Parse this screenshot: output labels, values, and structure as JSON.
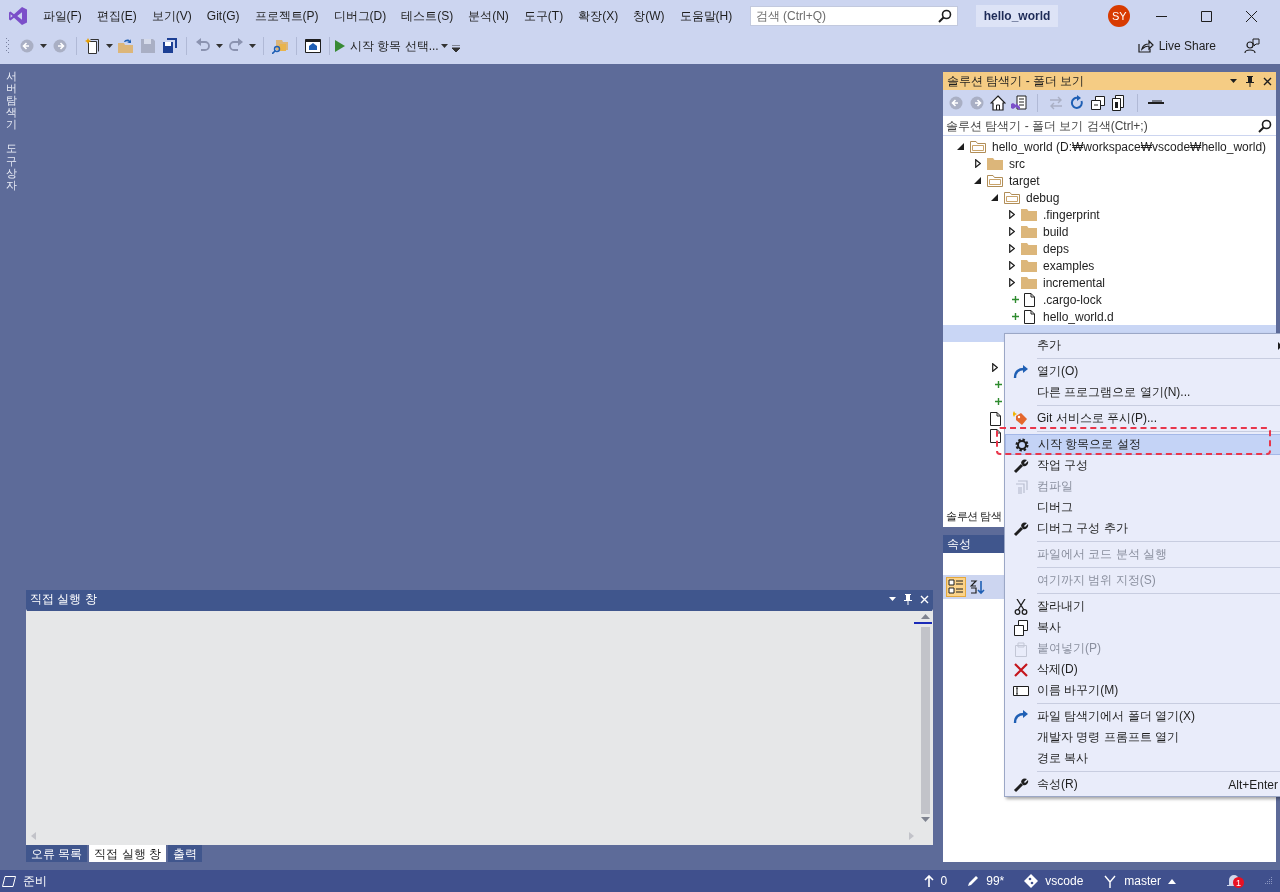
{
  "menu_bar": {
    "items": [
      "파일(F)",
      "편집(E)",
      "보기(V)",
      "Git(G)",
      "프로젝트(P)",
      "디버그(D)",
      "테스트(S)",
      "분석(N)",
      "도구(T)",
      "확장(X)",
      "창(W)",
      "도움말(H)"
    ]
  },
  "search": {
    "placeholder": "검색 (Ctrl+Q)"
  },
  "project_name": "hello_world",
  "account": {
    "initials": "SY"
  },
  "toolbar": {
    "start_button": "시작 항목 선택...",
    "live_share": "Live Share"
  },
  "side_tabs": [
    "서버 탐색기",
    "도구 상자"
  ],
  "solution_explorer": {
    "title": "솔루션 탐색기 - 폴더 보기",
    "search": {
      "placeholder": "솔루션 탐색기 - 폴더 보기 검색(Ctrl+;)"
    },
    "tree": [
      {
        "label": "hello_world (D:₩workspace₩vscode₩hello_world)",
        "kind": "folder",
        "expanded": true,
        "selected": false,
        "children": [
          {
            "label": "src",
            "kind": "folder",
            "expanded": false,
            "selected": false
          },
          {
            "label": "target",
            "kind": "folder",
            "expanded": true,
            "selected": false,
            "children": [
              {
                "label": "debug",
                "kind": "folder",
                "expanded": true,
                "selected": false,
                "children": [
                  {
                    "label": ".fingerprint",
                    "kind": "folder",
                    "expanded": false,
                    "selected": false
                  },
                  {
                    "label": "build",
                    "kind": "folder",
                    "expanded": false,
                    "selected": false
                  },
                  {
                    "label": "deps",
                    "kind": "folder",
                    "expanded": false,
                    "selected": false
                  },
                  {
                    "label": "examples",
                    "kind": "folder",
                    "expanded": false,
                    "selected": false
                  },
                  {
                    "label": "incremental",
                    "kind": "folder",
                    "expanded": false,
                    "selected": false
                  },
                  {
                    "label": ".cargo-lock",
                    "kind": "file",
                    "added": true,
                    "selected": false
                  },
                  {
                    "label": "hello_world.d",
                    "kind": "file",
                    "added": true,
                    "selected": false
                  },
                  {
                    "kind": "file",
                    "added": false,
                    "selected": true
                  },
                  {
                    "kind": "file",
                    "added": false,
                    "selected": false
                  }
                ]
              },
              {
                "kind": "folder",
                "expanded": false,
                "selected": false
              },
              {
                "kind": "file",
                "added": true,
                "selected": false
              },
              {
                "kind": "file",
                "added": true,
                "selected": false
              }
            ]
          },
          {
            "kind": "file",
            "added": false,
            "selected": false
          },
          {
            "kind": "file",
            "added": false,
            "selected": false
          }
        ]
      }
    ],
    "tabs": [
      {
        "label": "솔루션 탐색",
        "selected": true
      }
    ]
  },
  "properties": {
    "title": "속성"
  },
  "immediate_window": {
    "title": "직접 실행 창",
    "tabs": [
      {
        "label": "오류 목록",
        "selected": false
      },
      {
        "label": "직접 실행 창",
        "selected": true
      },
      {
        "label": "출력",
        "selected": false
      }
    ]
  },
  "context_menu": {
    "items": [
      {
        "kind": "item",
        "label": "추가",
        "disabled": false,
        "selected": false,
        "submenu": true
      },
      {
        "kind": "separator"
      },
      {
        "kind": "item",
        "label": "열기(O)",
        "disabled": false,
        "selected": false,
        "submenu": false
      },
      {
        "kind": "item",
        "label": "다른 프로그램으로 열기(N)...",
        "disabled": false,
        "selected": false,
        "submenu": false
      },
      {
        "kind": "separator"
      },
      {
        "kind": "item",
        "label": "Git 서비스로 푸시(P)...",
        "disabled": false,
        "selected": false,
        "submenu": false
      },
      {
        "kind": "separator"
      },
      {
        "kind": "item",
        "label": "시작 항목으로 설정",
        "disabled": false,
        "selected": true,
        "submenu": false
      },
      {
        "kind": "item",
        "label": "작업 구성",
        "disabled": false,
        "selected": false,
        "submenu": false
      },
      {
        "kind": "item",
        "label": "컴파일",
        "disabled": true,
        "selected": false,
        "submenu": false
      },
      {
        "kind": "item",
        "label": "디버그",
        "disabled": false,
        "selected": false,
        "submenu": false
      },
      {
        "kind": "item",
        "label": "디버그 구성 추가",
        "disabled": false,
        "selected": false,
        "submenu": false
      },
      {
        "kind": "separator"
      },
      {
        "kind": "item",
        "label": "파일에서 코드 분석 실행",
        "disabled": true,
        "selected": false,
        "submenu": false
      },
      {
        "kind": "separator"
      },
      {
        "kind": "item",
        "label": "여기까지 범위 지정(S)",
        "disabled": true,
        "selected": false,
        "submenu": false
      },
      {
        "kind": "separator"
      },
      {
        "kind": "item",
        "label": "잘라내기",
        "disabled": false,
        "selected": false,
        "submenu": false
      },
      {
        "kind": "item",
        "label": "복사",
        "disabled": false,
        "selected": false,
        "submenu": false
      },
      {
        "kind": "item",
        "label": "붙여넣기(P)",
        "disabled": true,
        "selected": false,
        "submenu": false
      },
      {
        "kind": "item",
        "label": "삭제(D)",
        "disabled": false,
        "selected": false,
        "submenu": false
      },
      {
        "kind": "item",
        "label": "이름 바꾸기(M)",
        "disabled": false,
        "selected": false,
        "submenu": false
      },
      {
        "kind": "separator"
      },
      {
        "kind": "item",
        "label": "파일 탐색기에서 폴더 열기(X)",
        "disabled": false,
        "selected": false,
        "submenu": false
      },
      {
        "kind": "item",
        "label": "개발자 명령 프롬프트 열기",
        "disabled": false,
        "selected": false,
        "submenu": false
      },
      {
        "kind": "item",
        "label": "경로 복사",
        "disabled": false,
        "selected": false,
        "submenu": false
      },
      {
        "kind": "separator"
      },
      {
        "kind": "item",
        "label": "속성(R)",
        "disabled": false,
        "selected": false,
        "submenu": false,
        "shortcut": "Alt+Enter"
      }
    ]
  },
  "status_bar": {
    "message": "준비",
    "push_count": "0",
    "changes": "99*",
    "repository": "vscode",
    "branch": "master",
    "notifications": "1"
  }
}
